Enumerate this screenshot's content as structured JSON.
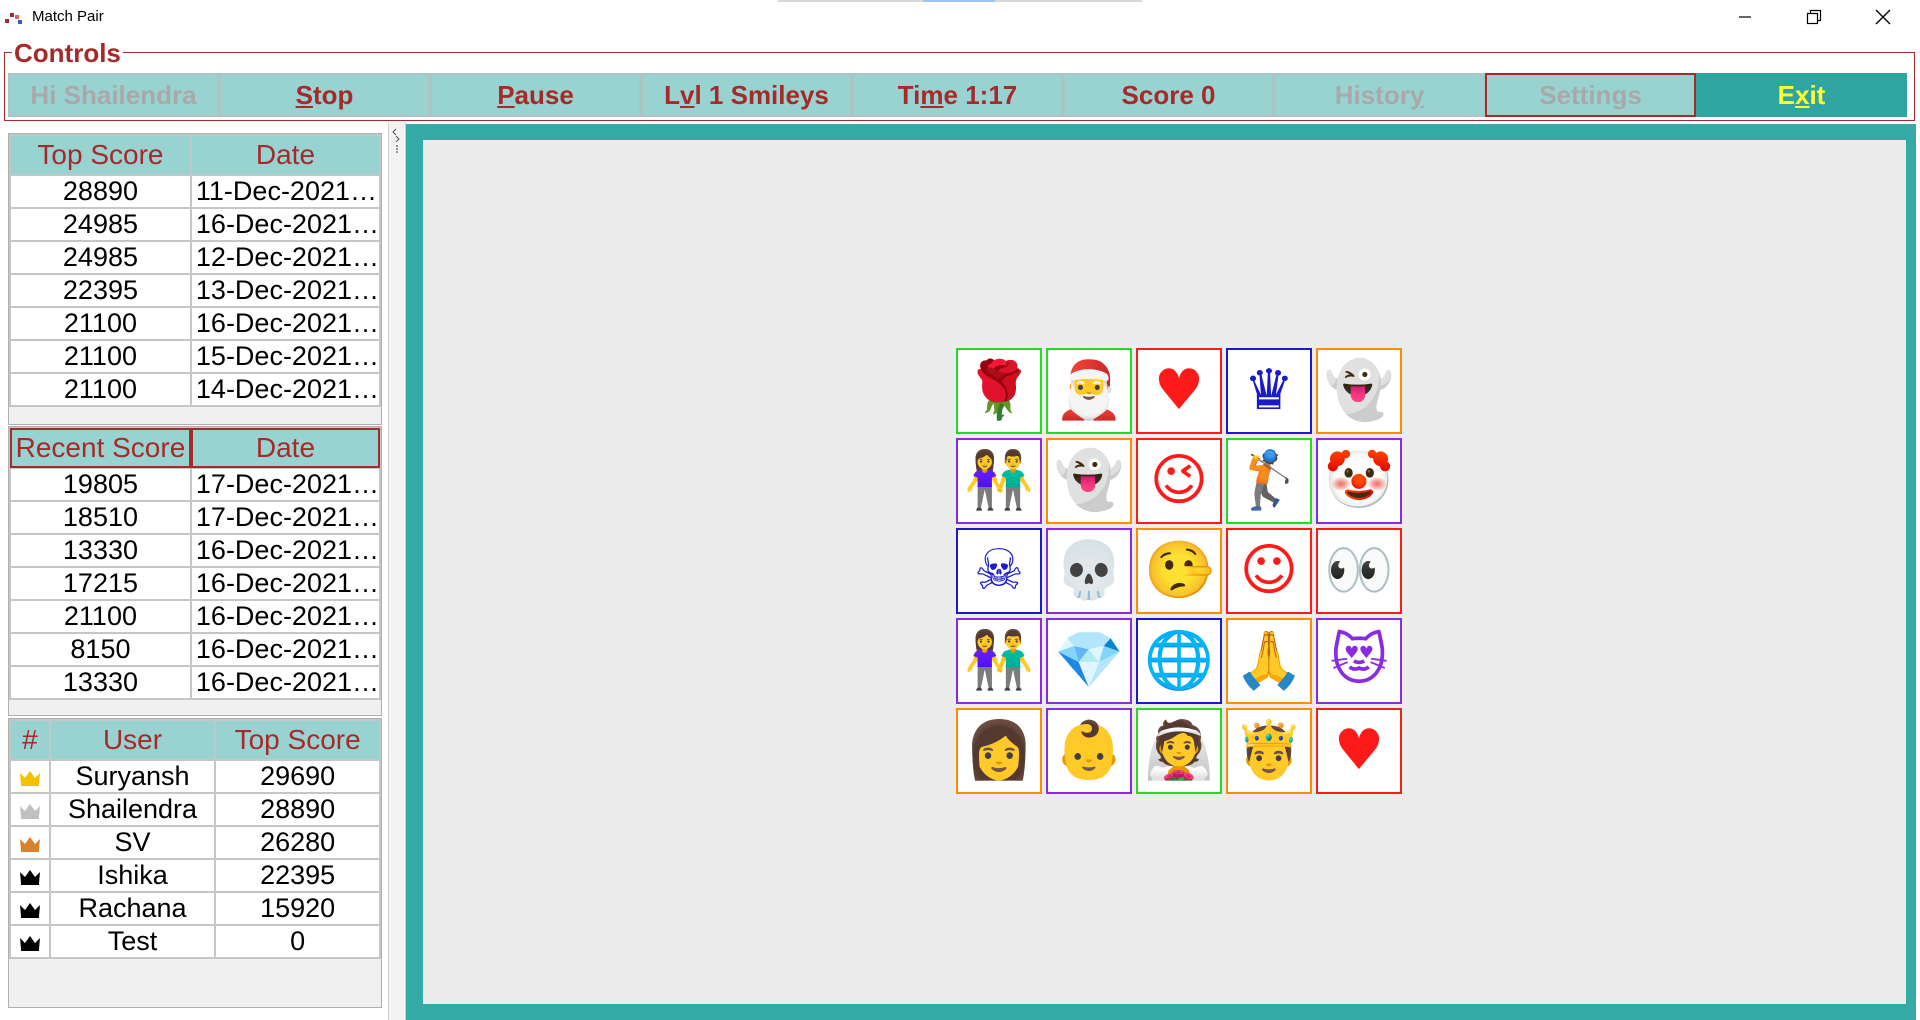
{
  "window": {
    "title": "Match Pair",
    "minimize_icon": "minimize-icon",
    "restore_icon": "restore-icon",
    "close_icon": "close-icon"
  },
  "controls": {
    "legend": "Controls",
    "greeting": "Hi Shailendra",
    "stop": {
      "pre": "",
      "ul": "S",
      "post": "top"
    },
    "pause": {
      "pre": "",
      "ul": "P",
      "post": "ause"
    },
    "level": {
      "pre": "L",
      "ul": "v",
      "post": "l 1 Smileys"
    },
    "time": {
      "pre": "Ti",
      "ul": "m",
      "post": "e 1:17"
    },
    "score": "Score 0",
    "history": {
      "pre": "Histor",
      "ul": "y",
      "post": ""
    },
    "settings": {
      "pre": "Settin",
      "ul": "g",
      "post": "s"
    },
    "exit": {
      "pre": "E",
      "ul": "x",
      "post": "it"
    }
  },
  "top_scores": {
    "headers": [
      "Top Score",
      "Date"
    ],
    "rows": [
      [
        "28890",
        "11-Dec-2021…"
      ],
      [
        "24985",
        "16-Dec-2021…"
      ],
      [
        "24985",
        "12-Dec-2021…"
      ],
      [
        "22395",
        "13-Dec-2021…"
      ],
      [
        "21100",
        "16-Dec-2021…"
      ],
      [
        "21100",
        "15-Dec-2021…"
      ],
      [
        "21100",
        "14-Dec-2021…"
      ]
    ]
  },
  "recent_scores": {
    "headers": [
      "Recent Score",
      "Date"
    ],
    "rows": [
      [
        "19805",
        "17-Dec-2021…"
      ],
      [
        "18510",
        "17-Dec-2021…"
      ],
      [
        "13330",
        "16-Dec-2021…"
      ],
      [
        "17215",
        "16-Dec-2021…"
      ],
      [
        "21100",
        "16-Dec-2021…"
      ],
      [
        "8150",
        "16-Dec-2021…"
      ],
      [
        "13330",
        "16-Dec-2021…"
      ]
    ]
  },
  "leaderboard": {
    "headers": [
      "#",
      "User",
      "Top Score"
    ],
    "rows": [
      {
        "crown": "gold-crown-icon",
        "crown_color": "#f2c200",
        "user": "Suryansh",
        "score": "29690"
      },
      {
        "crown": "silver-crown-icon",
        "crown_color": "#c0c0c0",
        "user": "Shailendra",
        "score": "28890"
      },
      {
        "crown": "bronze-crown-icon",
        "crown_color": "#d9822b",
        "user": "SV",
        "score": "26280"
      },
      {
        "crown": "black-crown-icon",
        "crown_color": "#000000",
        "user": "Ishika",
        "score": "22395"
      },
      {
        "crown": "black-crown-icon",
        "crown_color": "#000000",
        "user": "Rachana",
        "score": "15920"
      },
      {
        "crown": "black-crown-icon",
        "crown_color": "#000000",
        "user": "Test",
        "score": "0"
      }
    ]
  },
  "board": {
    "tiles": [
      {
        "icon": "rose-icon",
        "glyph": "🌹",
        "color": "#22dd22"
      },
      {
        "icon": "santa-icon",
        "glyph": "🎅",
        "color": "#22dd22"
      },
      {
        "icon": "heart-icon",
        "glyph": "♥",
        "color": "#ff1a1a"
      },
      {
        "icon": "crown-icon",
        "glyph": "♛",
        "color": "#1a1acc"
      },
      {
        "icon": "ghost-icon",
        "glyph": "👻",
        "color": "#ff8c00"
      },
      {
        "icon": "couple-icon",
        "glyph": "👫",
        "color": "#8a2be2"
      },
      {
        "icon": "ghost-icon",
        "glyph": "👻",
        "color": "#ff8c00"
      },
      {
        "icon": "winking-face-icon",
        "glyph": "😉",
        "color": "#ff1a1a"
      },
      {
        "icon": "golfer-icon",
        "glyph": "🏌",
        "color": "#22dd22"
      },
      {
        "icon": "clown-icon",
        "glyph": "🤡",
        "color": "#8a2be2"
      },
      {
        "icon": "skull-crossbones-icon",
        "glyph": "☠",
        "color": "#1a1acc"
      },
      {
        "icon": "skull-icon",
        "glyph": "💀",
        "color": "#8a2be2"
      },
      {
        "icon": "lying-face-icon",
        "glyph": "🤥",
        "color": "#ff8c00"
      },
      {
        "icon": "smiling-face-icon",
        "glyph": "☺",
        "color": "#ff1a1a"
      },
      {
        "icon": "eyes-icon",
        "glyph": "👀",
        "color": "#ff1a1a"
      },
      {
        "icon": "couple-icon",
        "glyph": "👫",
        "color": "#8a2be2"
      },
      {
        "icon": "gem-icon",
        "glyph": "💎",
        "color": "#8a2be2"
      },
      {
        "icon": "globe-icon",
        "glyph": "🌐",
        "color": "#1a1acc"
      },
      {
        "icon": "praying-person-icon",
        "glyph": "🙏",
        "color": "#ff8c00"
      },
      {
        "icon": "cat-heart-eyes-icon",
        "glyph": "😻",
        "color": "#8a2be2"
      },
      {
        "icon": "woman-icon",
        "glyph": "👩",
        "color": "#ff8c00"
      },
      {
        "icon": "baby-icon",
        "glyph": "👶",
        "color": "#8a2be2"
      },
      {
        "icon": "bride-icon",
        "glyph": "👰",
        "color": "#22dd22"
      },
      {
        "icon": "prince-icon",
        "glyph": "🤴",
        "color": "#ff8c00"
      },
      {
        "icon": "heart-icon",
        "glyph": "♥",
        "color": "#ff1a1a"
      }
    ]
  }
}
